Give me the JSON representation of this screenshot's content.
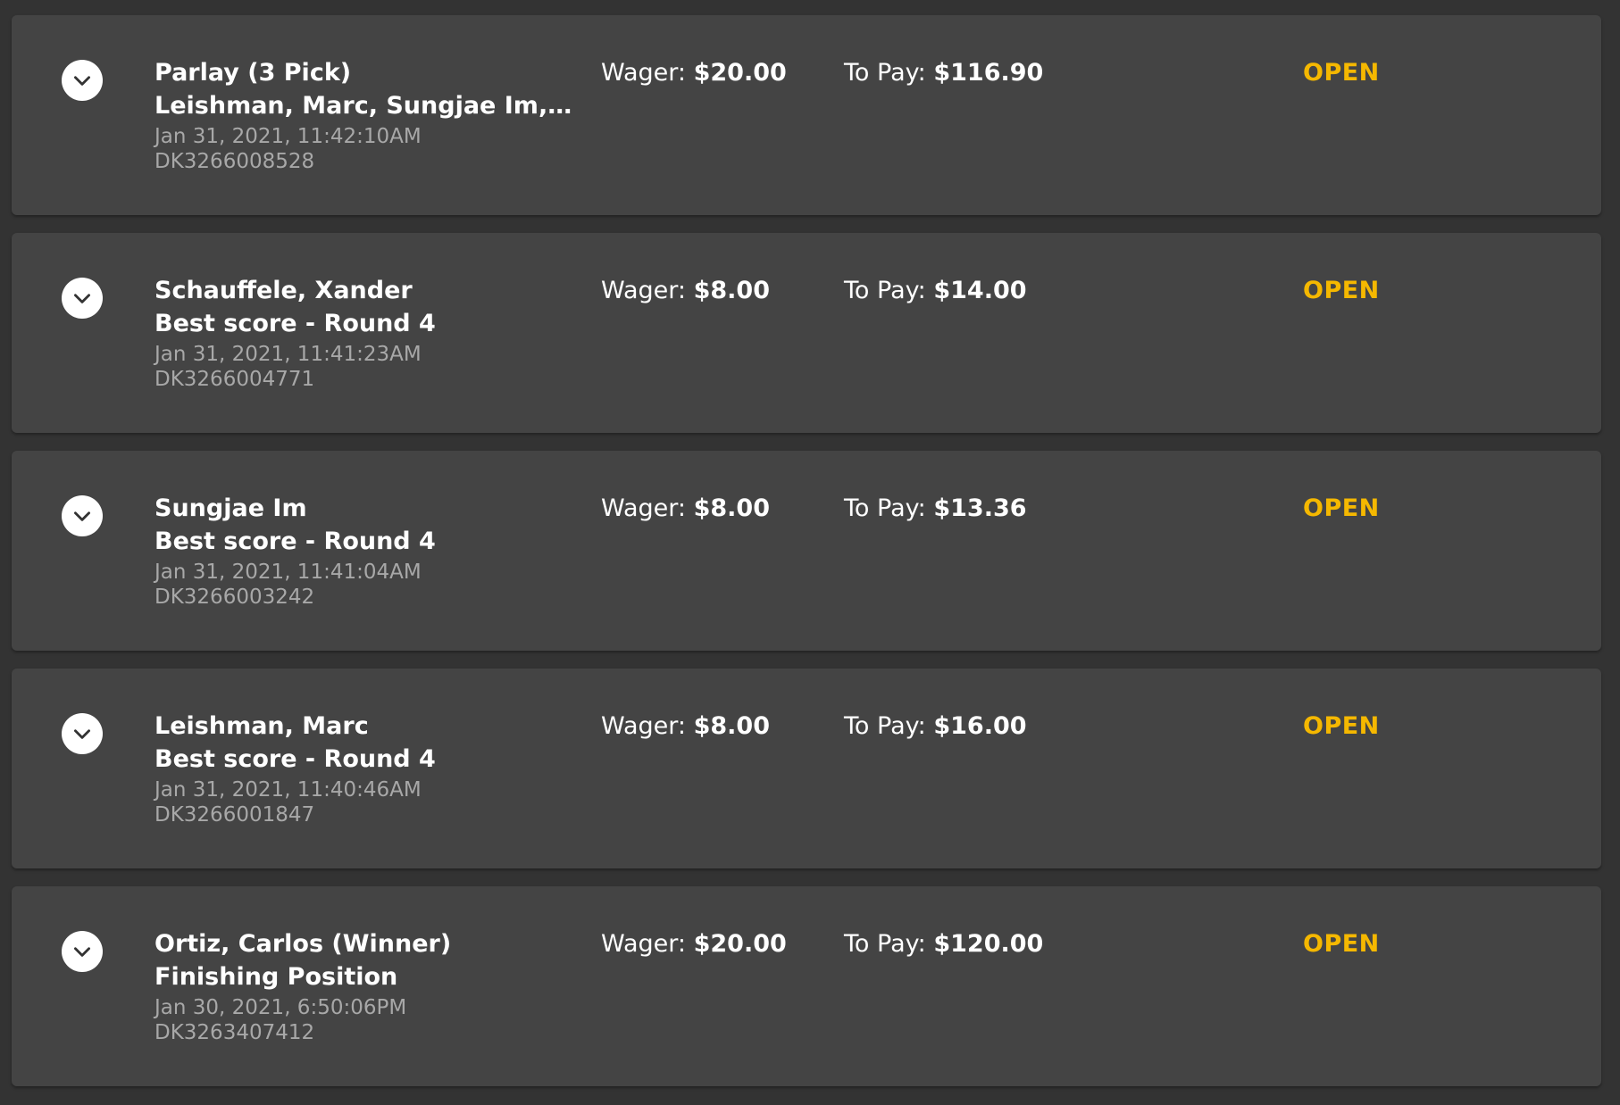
{
  "bets": [
    {
      "title": "Parlay (3 Pick)",
      "subtitle": "Leishman, Marc, Sungjae Im, S...",
      "date": "Jan 31, 2021, 11:42:10AM",
      "id": "DK3266008528",
      "wager_label": "Wager:",
      "wager": "$20.00",
      "to_pay_label": "To Pay:",
      "to_pay": "$116.90",
      "status": "OPEN"
    },
    {
      "title": "Schauffele, Xander",
      "subtitle": "Best score - Round 4",
      "date": "Jan 31, 2021, 11:41:23AM",
      "id": "DK3266004771",
      "wager_label": "Wager:",
      "wager": "$8.00",
      "to_pay_label": "To Pay:",
      "to_pay": "$14.00",
      "status": "OPEN"
    },
    {
      "title": "Sungjae Im",
      "subtitle": "Best score - Round 4",
      "date": "Jan 31, 2021, 11:41:04AM",
      "id": "DK3266003242",
      "wager_label": "Wager:",
      "wager": "$8.00",
      "to_pay_label": "To Pay:",
      "to_pay": "$13.36",
      "status": "OPEN"
    },
    {
      "title": "Leishman, Marc",
      "subtitle": "Best score - Round 4",
      "date": "Jan 31, 2021, 11:40:46AM",
      "id": "DK3266001847",
      "wager_label": "Wager:",
      "wager": "$8.00",
      "to_pay_label": "To Pay:",
      "to_pay": "$16.00",
      "status": "OPEN"
    },
    {
      "title": "Ortiz, Carlos (Winner)",
      "subtitle": "Finishing Position",
      "date": "Jan 30, 2021, 6:50:06PM",
      "id": "DK3263407412",
      "wager_label": "Wager:",
      "wager": "$20.00",
      "to_pay_label": "To Pay:",
      "to_pay": "$120.00",
      "status": "OPEN"
    }
  ],
  "icons": {
    "expand": "chevron-down-icon"
  },
  "colors": {
    "page_background": "#333333",
    "card_background": "#444444",
    "status_open": "#f5b800",
    "muted_text": "#a8a8a8"
  }
}
